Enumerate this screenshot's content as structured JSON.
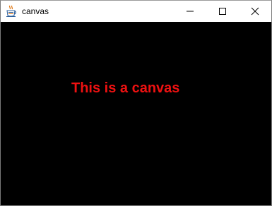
{
  "window": {
    "title": "canvas",
    "icon": "java-coffee-cup-icon",
    "controls": [
      "minimize-icon",
      "maximize-icon",
      "close-icon"
    ]
  },
  "canvas": {
    "text": "This is a canvas",
    "background_color": "#000000",
    "text_color": "#ee1111"
  }
}
